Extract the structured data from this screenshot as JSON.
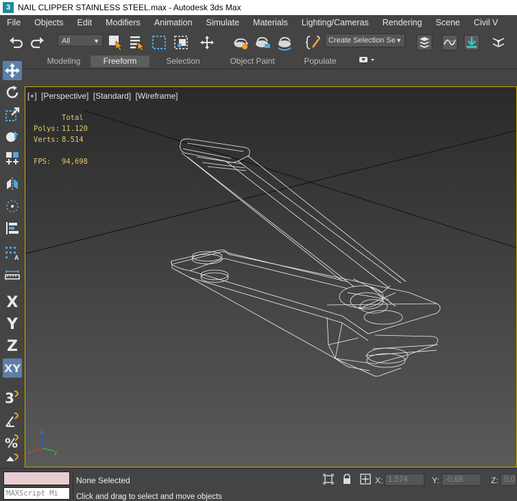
{
  "window": {
    "title": "NAIL CLIPPER STAINLESS STEEL.max - Autodesk 3ds Max",
    "app_icon": "3"
  },
  "menu": [
    "File",
    "Objects",
    "Edit",
    "Modifiers",
    "Animation",
    "Simulate",
    "Materials",
    "Lighting/Cameras",
    "Rendering",
    "Scene",
    "Civil V"
  ],
  "toolbar": {
    "selection_filter": "All",
    "named_selection": "Create Selection Se",
    "icons": [
      "undo-icon",
      "redo-icon",
      "select-object-icon",
      "select-by-name-icon",
      "rect-selection-region-icon",
      "window-crossing-icon",
      "select-move-icon",
      "hierarchy-settings-icon",
      "render-setup-icon",
      "render-frame-icon",
      "render-icon",
      "edit-named-selections-icon",
      "layer-explorer-icon",
      "curve-editor-icon",
      "schematic-view-icon",
      "snaps-icon"
    ]
  },
  "ribbon": {
    "tabs": [
      "Modeling",
      "Freeform",
      "Selection",
      "Object Paint",
      "Populate"
    ],
    "active_tab": "Freeform"
  },
  "left_tools": {
    "axis": [
      "X",
      "Y",
      "Z",
      "XY"
    ],
    "active": "select-and-move"
  },
  "viewport": {
    "labels": [
      "[+]",
      "[Perspective]",
      "[Standard]",
      "[Wireframe]"
    ],
    "stats": {
      "header": "Total",
      "polys_label": "Polys:",
      "polys": "11.120",
      "verts_label": "Verts:",
      "verts": "8.514",
      "fps_label": "FPS:",
      "fps": "94,698"
    },
    "border_color": "#c9a700",
    "stats_color": "#e8c66a"
  },
  "status": {
    "selection": "None Selected",
    "prompt": "Click and drag to select and move objects",
    "maxscript_placeholder": "MAXScript Mi",
    "x_label": "X:",
    "x_value": "1,574",
    "y_label": "Y:",
    "y_value": "-0,68",
    "z_label": "Z:",
    "z_value": "0,0"
  }
}
